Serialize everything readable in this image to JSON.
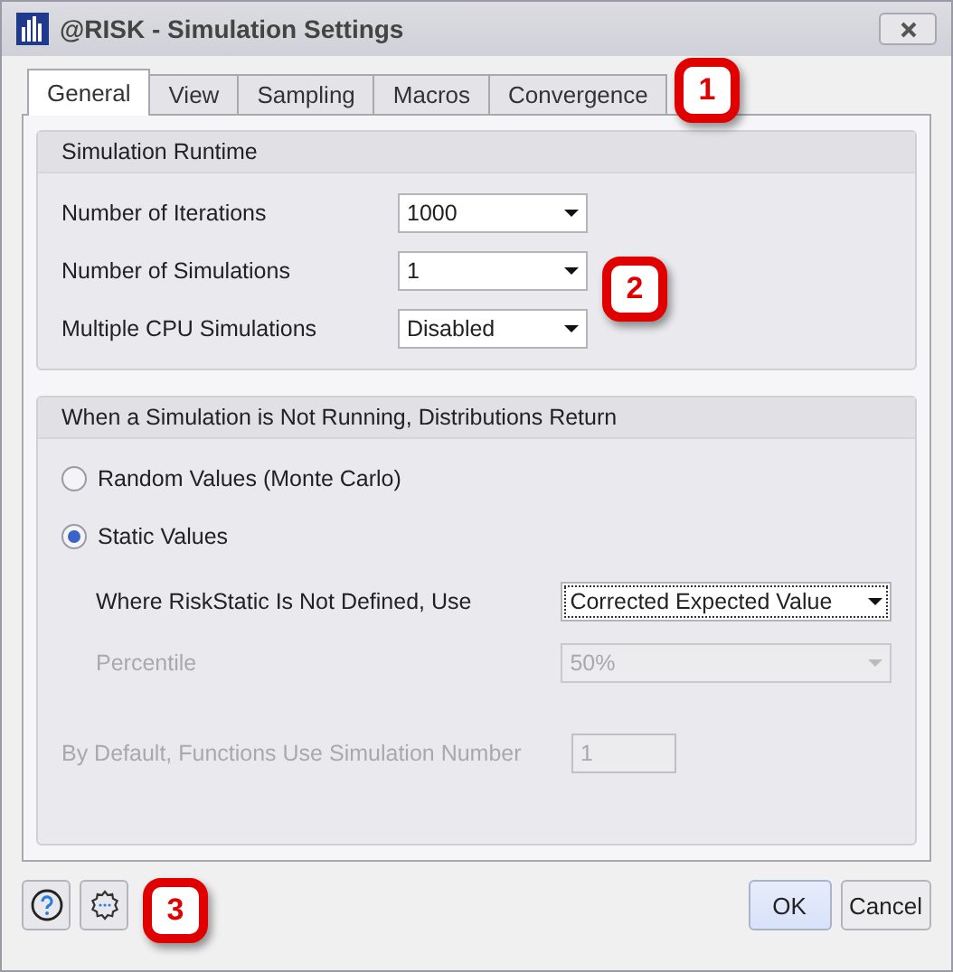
{
  "window": {
    "title": "@RISK - Simulation Settings"
  },
  "tabs": [
    {
      "label": "General",
      "selected": true
    },
    {
      "label": "View",
      "selected": false
    },
    {
      "label": "Sampling",
      "selected": false
    },
    {
      "label": "Macros",
      "selected": false
    },
    {
      "label": "Convergence",
      "selected": false
    }
  ],
  "sections": [
    {
      "title": "Simulation Runtime",
      "rows": [
        {
          "kind": "dropdown",
          "label": "Number of Iterations",
          "value": "1000",
          "disabled": false,
          "focused": false
        },
        {
          "kind": "dropdown",
          "label": "Number of Simulations",
          "value": "1",
          "disabled": false,
          "focused": false
        },
        {
          "kind": "dropdown",
          "label": "Multiple CPU Simulations",
          "value": "Disabled",
          "disabled": false,
          "focused": false
        }
      ]
    },
    {
      "title": "When a Simulation is Not Running, Distributions Return",
      "rows": [
        {
          "kind": "radio",
          "label": "Random Values (Monte Carlo)",
          "selected": false
        },
        {
          "kind": "radio",
          "label": "Static Values",
          "selected": true,
          "children": [
            {
              "kind": "dropdown",
              "label": "Where RiskStatic Is Not Defined, Use",
              "value": "Corrected Expected Value",
              "disabled": false,
              "focused": true
            },
            {
              "kind": "dropdown",
              "label": "Percentile",
              "value": "50%",
              "disabled": true,
              "focused": false
            }
          ]
        },
        {
          "kind": "textbox",
          "label": "By Default, Functions Use Simulation Number",
          "value": "1",
          "disabled": true
        }
      ]
    }
  ],
  "buttons": [
    {
      "label": "OK",
      "default": true
    },
    {
      "label": "Cancel",
      "default": false
    }
  ],
  "callouts": [
    {
      "text": "1"
    },
    {
      "text": "2"
    },
    {
      "text": "3"
    }
  ]
}
